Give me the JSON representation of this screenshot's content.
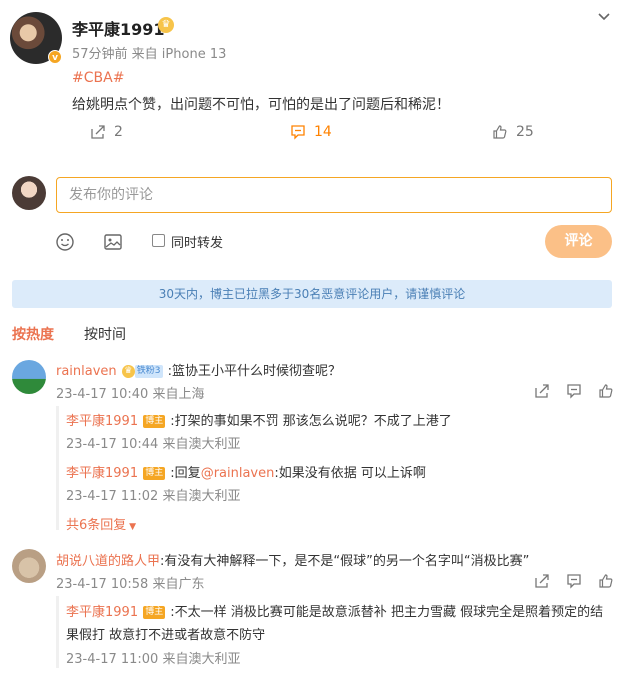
{
  "post": {
    "author": "李平康1991",
    "meta": "57分钟前  来自 iPhone 13",
    "hashtag": "#CBA#",
    "text": "给姚明点个赞，出问题不可怕，可怕的是出了问题后和稀泥！",
    "forward_count": "2",
    "comment_count": "14",
    "like_count": "25"
  },
  "compose": {
    "placeholder": "发布你的评论",
    "repost_label": "同时转发",
    "submit_label": "评论"
  },
  "notice": "30天内，博主已拉黑多于30名恶意评论用户，请谨慎评论",
  "sort": {
    "hot": "按热度",
    "time": "按时间"
  },
  "badges": {
    "blogger": "博主",
    "fan": "铁粉3"
  },
  "comments": [
    {
      "name": "rainlaven",
      "text": ":篮协王小平什么时候彻查呢？",
      "meta": "23-4-17 10:40 来自上海",
      "replies": [
        {
          "name": "李平康1991",
          "text": ":打架的事如果不罚 那该怎么说呢？不成了上港了",
          "meta": "23-4-17 10:44 来自澳大利亚"
        },
        {
          "name": "李平康1991",
          "text_prefix": ":回复",
          "mention": "@rainlaven",
          "text": ":如果没有依据 可以上诉啊",
          "meta": "23-4-17 11:02 来自澳大利亚"
        }
      ],
      "more": "共6条回复"
    },
    {
      "name": "胡说八道的路人甲",
      "text": ":有没有大神解释一下，是不是“假球”的另一个名字叫“消极比赛”",
      "meta": "23-4-17 10:58 来自广东",
      "replies": [
        {
          "name": "李平康1991",
          "text_line1": ":不太一样 消极比赛可能是故意派替补 把主力雪藏 假球完全是照着预定的结",
          "text_line2": "果假打 故意打不进或者故意不防守",
          "meta": "23-4-17 11:00 来自澳大利亚"
        }
      ]
    }
  ]
}
